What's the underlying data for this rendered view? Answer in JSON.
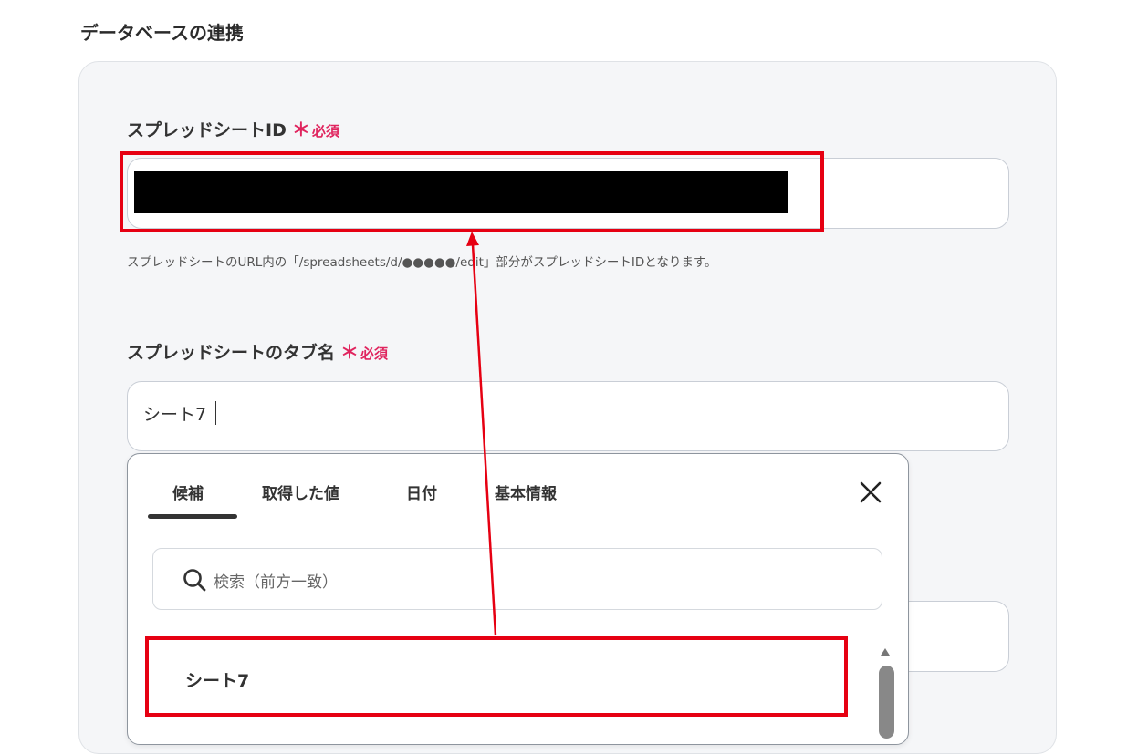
{
  "section_title": "データベースの連携",
  "spreadsheet_id": {
    "label": "スプレッドシートID",
    "required_mark": "＊",
    "required_text": "必須",
    "hint": "スプレッドシートのURL内の「/spreadsheets/d/●●●●●/edit」部分がスプレッドシートIDとなります。"
  },
  "tab_name": {
    "label": "スプレッドシートのタブ名",
    "required_mark": "＊",
    "required_text": "必須",
    "value": "シート7"
  },
  "dropdown": {
    "tabs": [
      "候補",
      "取得した値",
      "日付",
      "基本情報"
    ],
    "active_tab": "候補",
    "search_placeholder": "検索（前方一致）",
    "items": [
      "シート7"
    ]
  },
  "colors": {
    "annotation_red": "#e60012",
    "required_pink": "#e0245e"
  },
  "icons": [
    "close-icon",
    "search-icon",
    "scroll-up-icon"
  ]
}
